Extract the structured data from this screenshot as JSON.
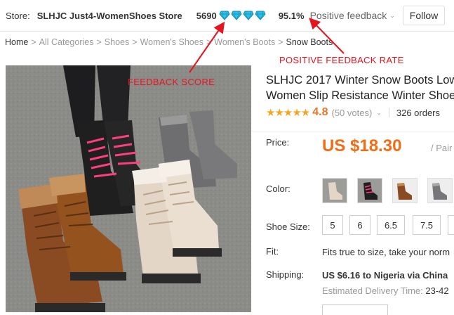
{
  "store": {
    "label": "Store:",
    "name": "SLHJC Just4-WomenShoes Store",
    "feedback_score": "5690",
    "diamond_icon": "diamond-icon",
    "diamond_count": 4,
    "positive_rate": "95.1%",
    "feedback_label": "Positive feedback",
    "follow_label": "Follow"
  },
  "breadcrumb": [
    "Home",
    "All Categories",
    "Shoes",
    "Women's Shoes",
    "Women's Boots",
    "Snow Boots"
  ],
  "annotations": {
    "feedback_score": "FEEDBACK SCORE",
    "positive_rate": "POSITIVE FEEDBACK RATE",
    "color": "#e6141e"
  },
  "product": {
    "title_line1": "SLHJC 2017 Winter Snow Boots Low",
    "title_line2": "Women Slip Resistance Winter Shoe",
    "rating": "4.8",
    "votes": "(50 votes)",
    "orders": "326 orders",
    "price_label": "Price:",
    "price": "US $18.30",
    "unit": "/ Pair",
    "color_label": "Color:",
    "swatches": [
      "beige boot",
      "black pink boot",
      "brown boot",
      "grey boot"
    ],
    "size_label": "Shoe Size:",
    "sizes": [
      "5",
      "6",
      "6.5",
      "7.5"
    ],
    "fit_label": "Fit:",
    "fit_value": "Fits true to size, take your norm",
    "shipping_label": "Shipping:",
    "shipping_value": "US $6.16 to Nigeria via China",
    "delivery_label": "Estimated Delivery Time:",
    "delivery_value": "23-42"
  },
  "colors": {
    "price": "#f36c15",
    "rating": "#e8752a",
    "stars": "#f5a623",
    "diamond": "#1fb3d9"
  }
}
